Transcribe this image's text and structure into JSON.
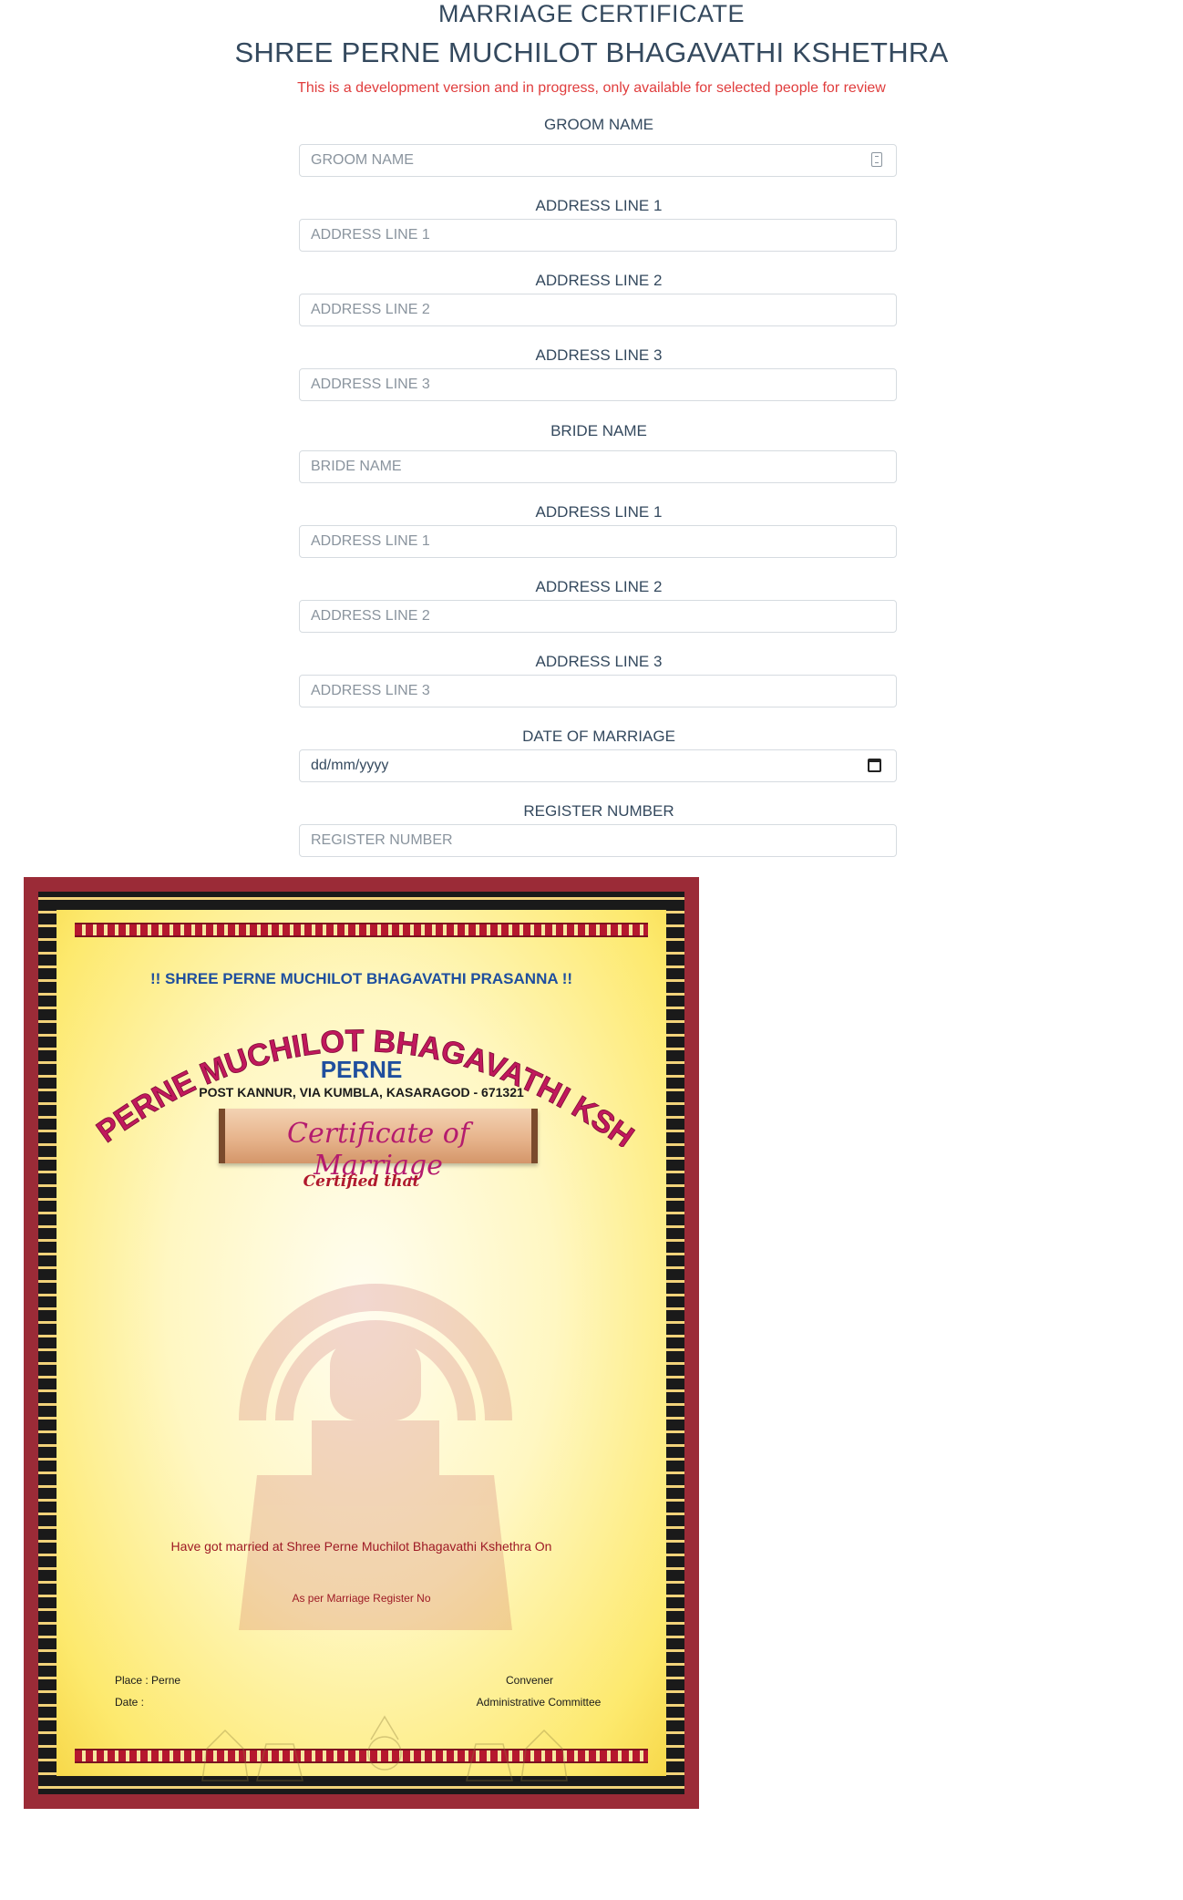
{
  "header": {
    "title": "MARRIAGE CERTIFICATE",
    "subtitle": "SHREE PERNE MUCHILOT BHAGAVATHI KSHETHRA",
    "notice": "This is a development version and in progress, only available for selected people for review"
  },
  "form": {
    "groom_name": {
      "label": "GROOM NAME",
      "placeholder": "GROOM NAME"
    },
    "groom_addr1": {
      "label": "ADDRESS LINE 1",
      "placeholder": "ADDRESS LINE 1"
    },
    "groom_addr2": {
      "label": "ADDRESS LINE 2",
      "placeholder": "ADDRESS LINE 2"
    },
    "groom_addr3": {
      "label": "ADDRESS LINE 3",
      "placeholder": "ADDRESS LINE 3"
    },
    "bride_name": {
      "label": "BRIDE NAME",
      "placeholder": "BRIDE NAME"
    },
    "bride_addr1": {
      "label": "ADDRESS LINE 1",
      "placeholder": "ADDRESS LINE 1"
    },
    "bride_addr2": {
      "label": "ADDRESS LINE 2",
      "placeholder": "ADDRESS LINE 2"
    },
    "bride_addr3": {
      "label": "ADDRESS LINE 3",
      "placeholder": "ADDRESS LINE 3"
    },
    "date_of_marriage": {
      "label": "DATE OF MARRIAGE",
      "value": "dd/mm/yyyy"
    },
    "register_number": {
      "label": "REGISTER NUMBER",
      "placeholder": "REGISTER NUMBER"
    }
  },
  "certificate": {
    "prasanna": "!! SHREE PERNE MUCHILOT BHAGAVATHI PRASANNA !!",
    "arc_title": "SHREE PERNE MUCHILOT BHAGAVATHI KSHETHRA",
    "place_name": "PERNE",
    "address": "POST KANNUR, VIA KUMBLA, KASARAGOD - 671321",
    "scroll_title": "Certificate of Marriage",
    "certified": "Certified that",
    "married_on": "Have got married at Shree Perne Muchilot Bhagavathi Kshethra On",
    "register_line": "As per Marriage Register No",
    "place": "Place : Perne",
    "date": "Date :",
    "convener": "Convener",
    "committee": "Administrative Committee"
  },
  "colors": {
    "frame": "#9b2b37",
    "notice": "#e03d3d",
    "arc_text": "#c0185c",
    "accent_blue": "#1f4f9e"
  }
}
